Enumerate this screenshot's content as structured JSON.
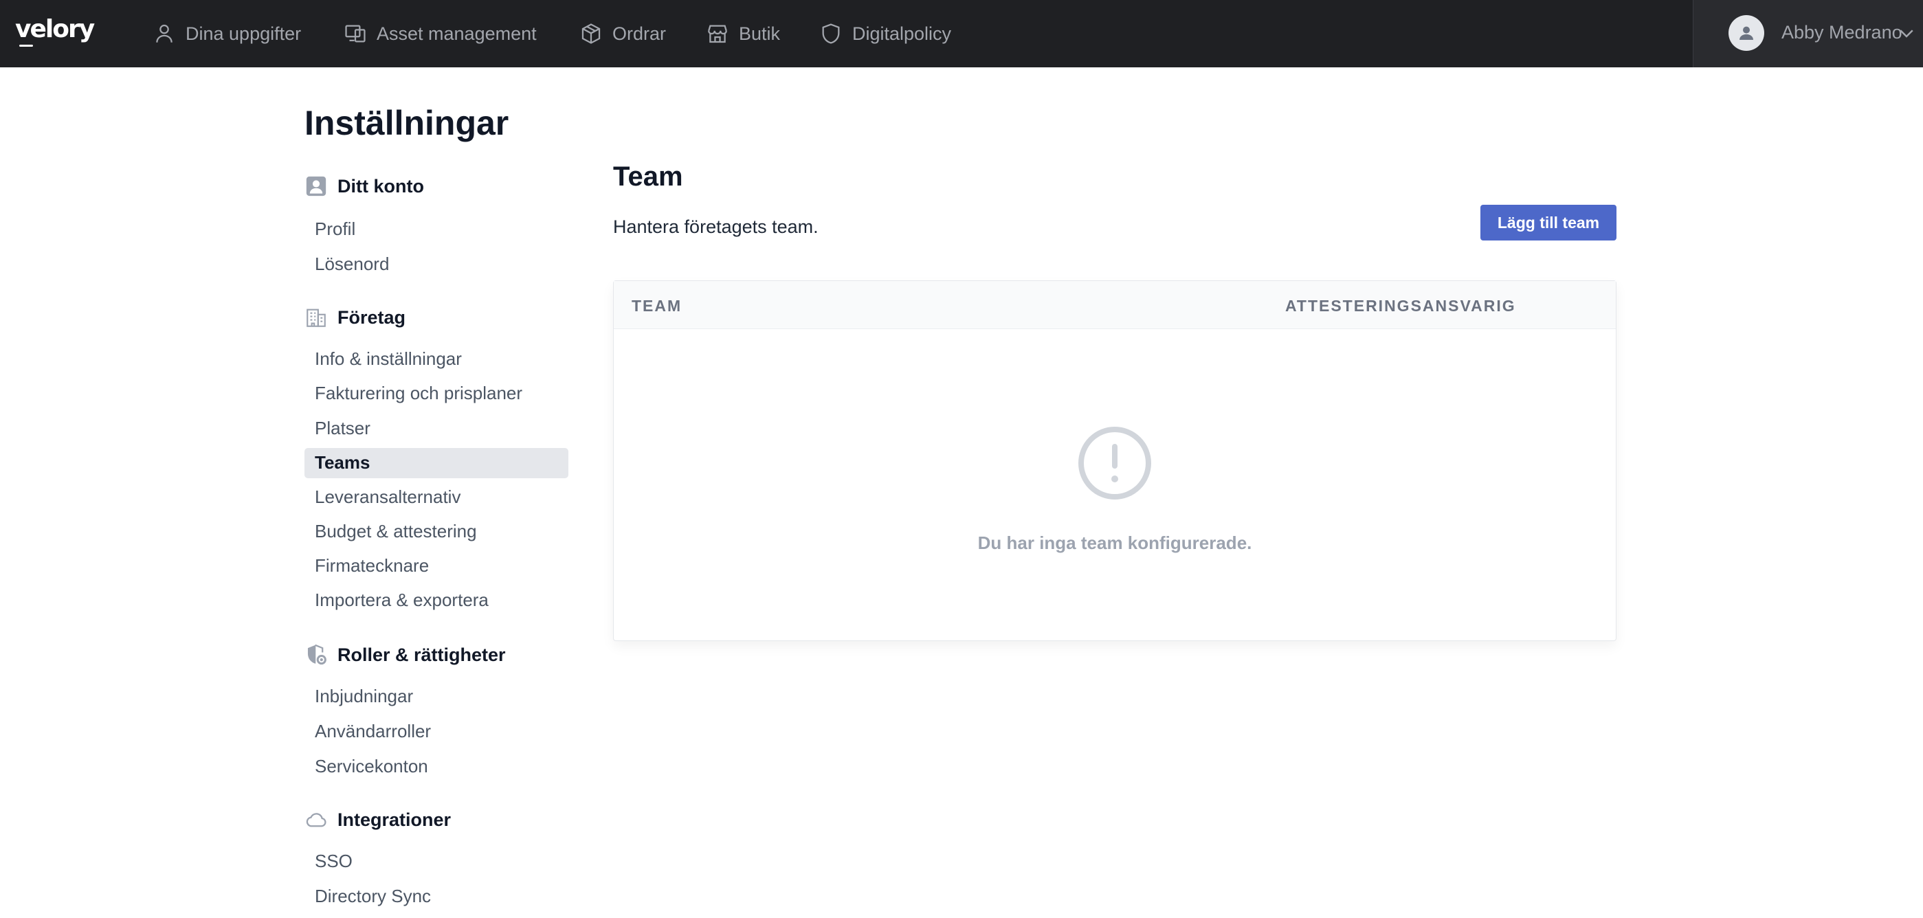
{
  "app": {
    "logo_text": "velory"
  },
  "nav": {
    "items": [
      {
        "label": "Dina uppgifter",
        "icon": "user-icon"
      },
      {
        "label": "Asset management",
        "icon": "devices-icon"
      },
      {
        "label": "Ordrar",
        "icon": "box-icon"
      },
      {
        "label": "Butik",
        "icon": "store-icon"
      },
      {
        "label": "Digitalpolicy",
        "icon": "shield-icon"
      }
    ]
  },
  "user": {
    "name": "Abby Medrano",
    "avatar_icon": "avatar-icon",
    "menu_icon": "chevron-down-icon"
  },
  "page": {
    "title": "Inställningar"
  },
  "sidebar": {
    "sections": [
      {
        "title": "Ditt konto",
        "icon": "account-icon",
        "items": [
          "Profil",
          "Lösenord"
        ]
      },
      {
        "title": "Företag",
        "icon": "building-icon",
        "items": [
          "Info & inställningar",
          "Fakturering och prisplaner",
          "Platser",
          "Teams",
          "Leveransalternativ",
          "Budget & attestering",
          "Firmatecknare",
          "Importera & exportera"
        ]
      },
      {
        "title": "Roller & rättigheter",
        "icon": "shield-lock-icon",
        "items": [
          "Inbjudningar",
          "Användarroller",
          "Servicekonton"
        ]
      },
      {
        "title": "Integrationer",
        "icon": "cloud-icon",
        "items": [
          "SSO",
          "Directory Sync"
        ]
      }
    ],
    "active_item": "Teams"
  },
  "main": {
    "title": "Team",
    "description": "Hantera företagets team.",
    "add_button_label": "Lägg till team",
    "table": {
      "columns": [
        "TEAM",
        "ATTESTERINGSANSVARIG"
      ],
      "rows": [],
      "empty_icon": "exclamation-circle-icon",
      "empty_message": "Du har inga team konfigurerade."
    }
  },
  "colors": {
    "topbar_bg": "#1f2023",
    "accent": "#4d68c9",
    "active_item_bg": "#e5e7eb"
  }
}
